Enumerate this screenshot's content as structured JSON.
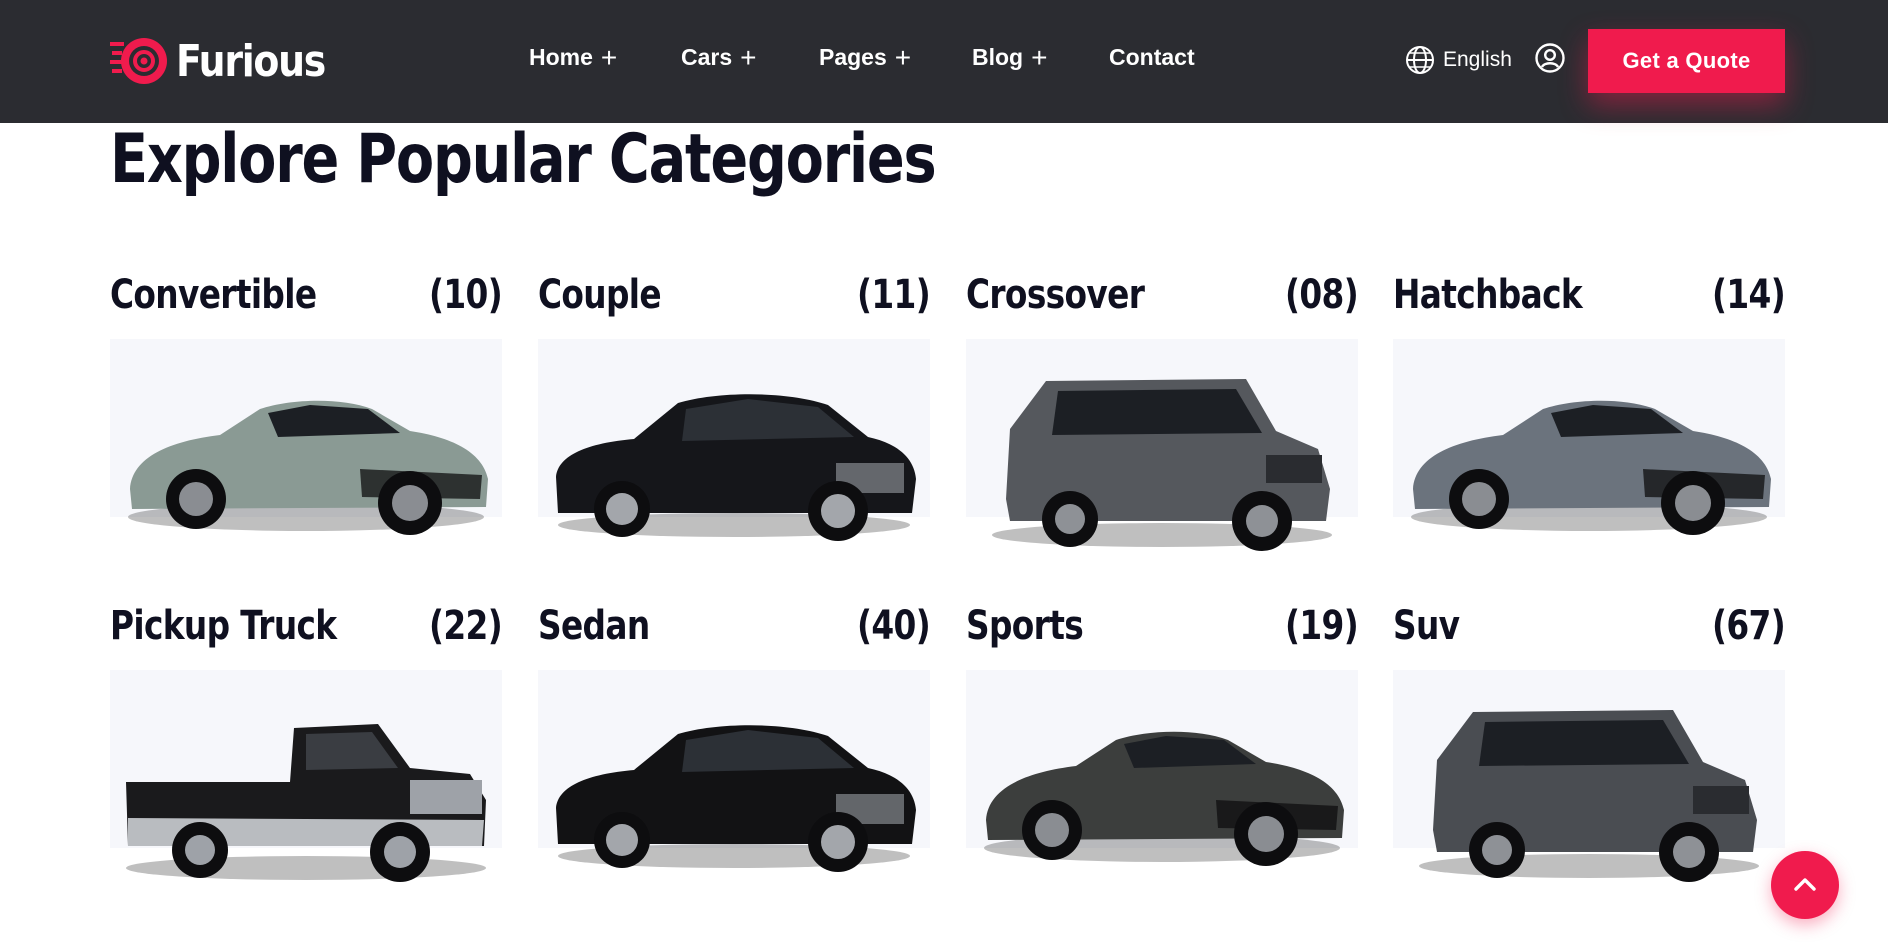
{
  "brand": {
    "name": "Furious",
    "accent": "#f01b4d",
    "header_bg": "#2b2c31"
  },
  "nav": {
    "items": [
      {
        "label": "Home",
        "suffix": "+"
      },
      {
        "label": "Cars",
        "suffix": "+"
      },
      {
        "label": "Pages",
        "suffix": "+"
      },
      {
        "label": "Blog",
        "suffix": "+"
      },
      {
        "label": "Contact",
        "suffix": ""
      }
    ],
    "language": "English",
    "language_icon": "globe-icon",
    "user_icon": "user-icon",
    "cta_label": "Get a Quote"
  },
  "section": {
    "title": "Explore Popular Categories"
  },
  "categories": [
    {
      "name": "Convertible",
      "count": "(10)",
      "car": "convertible",
      "color": "#8a9a94"
    },
    {
      "name": "Couple",
      "count": "(11)",
      "car": "sedan-luxury",
      "color": "#15161a"
    },
    {
      "name": "Crossover",
      "count": "(08)",
      "car": "crossover",
      "color": "#55585d"
    },
    {
      "name": "Hatchback",
      "count": "(14)",
      "car": "coupe",
      "color": "#6b737d"
    },
    {
      "name": "Pickup Truck",
      "count": "(22)",
      "car": "pickup",
      "color": "#1a1a1c"
    },
    {
      "name": "Sedan",
      "count": "(40)",
      "car": "sedan",
      "color": "#121214"
    },
    {
      "name": "Sports",
      "count": "(19)",
      "car": "muscle",
      "color": "#3c3e3d"
    },
    {
      "name": "Suv",
      "count": "(67)",
      "car": "suv",
      "color": "#4a4d52"
    }
  ],
  "scroll_top_icon": "chevron-up-icon"
}
